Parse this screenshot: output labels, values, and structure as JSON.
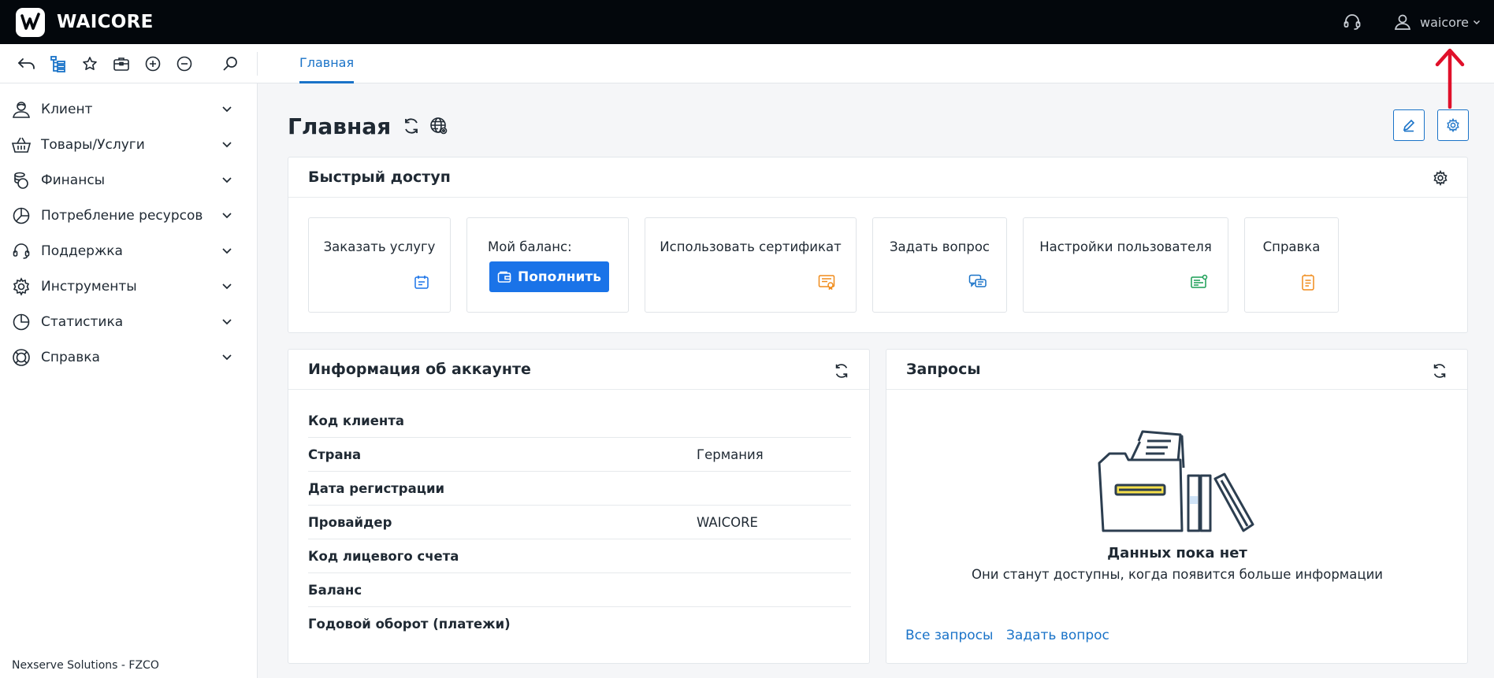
{
  "app": {
    "brand": "WAICORE",
    "username": "waicore"
  },
  "toolbar": {
    "active_tab": "Главная"
  },
  "sidebar": {
    "items": [
      {
        "label": "Клиент",
        "icon": "client-icon"
      },
      {
        "label": "Товары/Услуги",
        "icon": "basket-icon"
      },
      {
        "label": "Финансы",
        "icon": "coins-icon"
      },
      {
        "label": "Потребление ресурсов",
        "icon": "pie-chart-icon"
      },
      {
        "label": "Поддержка",
        "icon": "headset-icon"
      },
      {
        "label": "Инструменты",
        "icon": "gear-icon"
      },
      {
        "label": "Статистика",
        "icon": "pie-chart-icon"
      },
      {
        "label": "Справка",
        "icon": "lifebuoy-icon"
      }
    ],
    "footer": "Nexserve Solutions - FZCO"
  },
  "main": {
    "title": "Главная"
  },
  "quick_access": {
    "title": "Быстрый доступ",
    "tiles": [
      {
        "label": "Заказать услугу",
        "icon": "clipboard-icon"
      },
      {
        "label": "Мой баланс:",
        "button": "Пополнить"
      },
      {
        "label": "Использовать сертификат",
        "icon": "certificate-icon"
      },
      {
        "label": "Задать вопрос",
        "icon": "chat-icon"
      },
      {
        "label": "Настройки пользователя",
        "icon": "user-settings-icon"
      },
      {
        "label": "Справка",
        "icon": "document-icon"
      }
    ]
  },
  "account_info": {
    "title": "Информация об аккаунте",
    "rows": [
      {
        "label": "Код клиента",
        "value": ""
      },
      {
        "label": "Страна",
        "value": "Германия"
      },
      {
        "label": "Дата регистрации",
        "value": ""
      },
      {
        "label": "Провайдер",
        "value": "WAICORE"
      },
      {
        "label": "Код лицевого счета",
        "value": ""
      },
      {
        "label": "Баланс",
        "value": ""
      },
      {
        "label": "Годовой оборот (платежи)",
        "value": ""
      }
    ]
  },
  "requests": {
    "title": "Запросы",
    "empty_title": "Данных пока нет",
    "empty_subtitle": "Они станут доступны, когда появится больше информации",
    "links": [
      "Все запросы",
      "Задать вопрос"
    ]
  },
  "colors": {
    "accent": "#1a73c8",
    "button": "#1a73e8",
    "topbar": "#03070c",
    "annotation": "#e0102a"
  }
}
